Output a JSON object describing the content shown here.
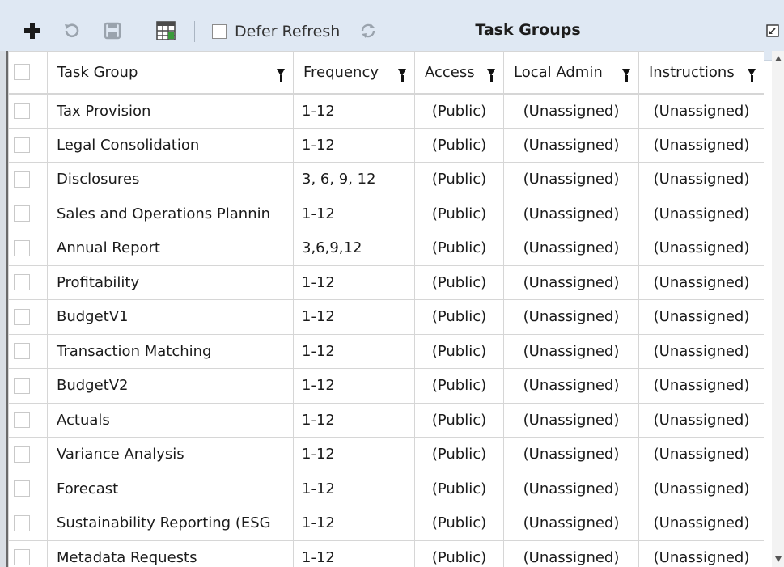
{
  "toolbar": {
    "title": "Task Groups",
    "defer_refresh_label": "Defer Refresh",
    "defer_refresh_checked": false,
    "icons": [
      "plus-icon",
      "undo-icon",
      "save-icon",
      "grid-settings-icon",
      "refresh-icon",
      "popout-icon"
    ]
  },
  "grid": {
    "columns": [
      "Task Group",
      "Frequency",
      "Access",
      "Local Admin",
      "Instructions"
    ],
    "rows": [
      {
        "task_group": "Tax Provision",
        "frequency": "1-12",
        "access": "(Public)",
        "local_admin": "(Unassigned)",
        "instructions": "(Unassigned)"
      },
      {
        "task_group": "Legal Consolidation",
        "frequency": "1-12",
        "access": "(Public)",
        "local_admin": "(Unassigned)",
        "instructions": "(Unassigned)"
      },
      {
        "task_group": "Disclosures",
        "frequency": "3, 6, 9, 12",
        "access": "(Public)",
        "local_admin": "(Unassigned)",
        "instructions": "(Unassigned)"
      },
      {
        "task_group": "Sales and Operations Plannin",
        "frequency": "1-12",
        "access": "(Public)",
        "local_admin": "(Unassigned)",
        "instructions": "(Unassigned)"
      },
      {
        "task_group": "Annual Report",
        "frequency": "3,6,9,12",
        "access": "(Public)",
        "local_admin": "(Unassigned)",
        "instructions": "(Unassigned)"
      },
      {
        "task_group": "Profitability",
        "frequency": "1-12",
        "access": "(Public)",
        "local_admin": "(Unassigned)",
        "instructions": "(Unassigned)"
      },
      {
        "task_group": "BudgetV1",
        "frequency": "1-12",
        "access": "(Public)",
        "local_admin": "(Unassigned)",
        "instructions": "(Unassigned)"
      },
      {
        "task_group": "Transaction Matching",
        "frequency": "1-12",
        "access": "(Public)",
        "local_admin": "(Unassigned)",
        "instructions": "(Unassigned)"
      },
      {
        "task_group": "BudgetV2",
        "frequency": "1-12",
        "access": "(Public)",
        "local_admin": "(Unassigned)",
        "instructions": "(Unassigned)"
      },
      {
        "task_group": "Actuals",
        "frequency": "1-12",
        "access": "(Public)",
        "local_admin": "(Unassigned)",
        "instructions": "(Unassigned)"
      },
      {
        "task_group": "Variance Analysis",
        "frequency": "1-12",
        "access": "(Public)",
        "local_admin": "(Unassigned)",
        "instructions": "(Unassigned)"
      },
      {
        "task_group": "Forecast",
        "frequency": "1-12",
        "access": "(Public)",
        "local_admin": "(Unassigned)",
        "instructions": "(Unassigned)"
      },
      {
        "task_group": "Sustainability Reporting (ESG",
        "frequency": "1-12",
        "access": "(Public)",
        "local_admin": "(Unassigned)",
        "instructions": "(Unassigned)"
      },
      {
        "task_group": "Metadata Requests",
        "frequency": "1-12",
        "access": "(Public)",
        "local_admin": "(Unassigned)",
        "instructions": "(Unassigned)"
      }
    ]
  },
  "colors": {
    "toolbar_bg": "#dfe8f3",
    "grid_border": "#d6d6d6",
    "icon_green": "#3a9a3a",
    "icon_gray": "#9aa3ad"
  }
}
